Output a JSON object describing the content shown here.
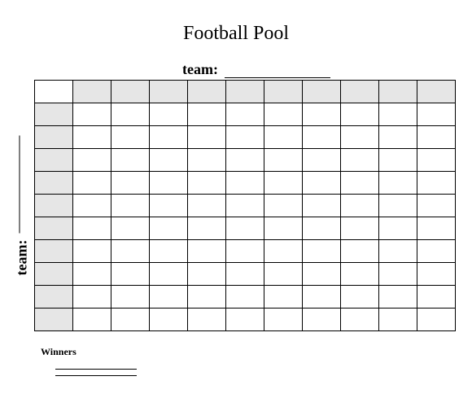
{
  "title": "Football Pool",
  "team_label_top": "team:",
  "team_label_side": "team:",
  "team_top_value": "",
  "team_side_value": "",
  "winners_label": "Winners",
  "grid": {
    "rows": 11,
    "cols": 11
  }
}
